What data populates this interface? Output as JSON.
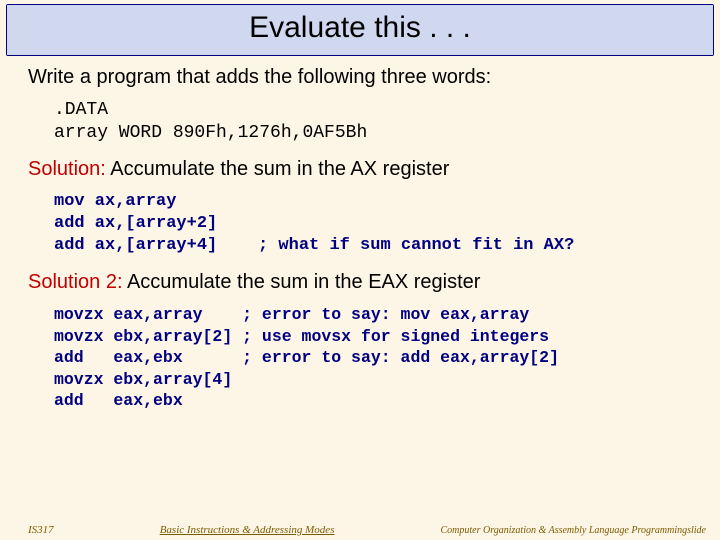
{
  "title": "Evaluate this . . .",
  "prompt": "Write a program that adds the following three words:",
  "code_data": ".DATA\narray WORD 890Fh,1276h,0AF5Bh",
  "solution1_label": "Solution:",
  "solution1_text": " Accumulate the sum in the AX register",
  "code_sol1": "mov ax,array\nadd ax,[array+2]\nadd ax,[array+4]    ; what if sum cannot fit in AX?",
  "solution2_label": "Solution 2:",
  "solution2_text": " Accumulate the sum in the EAX register",
  "code_sol2": "movzx eax,array    ; error to say: mov eax,array\nmovzx ebx,array[2] ; use movsx for signed integers\nadd   eax,ebx      ; error to say: add eax,array[2]\nmovzx ebx,array[4]\nadd   eax,ebx",
  "footer": {
    "left": "IS317",
    "mid": "Basic Instructions & Addressing Modes",
    "right": "Computer Organization & Assembly Language Programmingslide"
  }
}
